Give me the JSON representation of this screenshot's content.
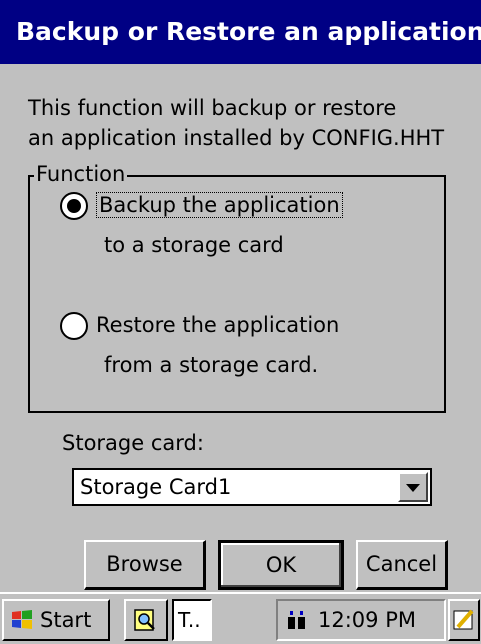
{
  "window": {
    "title": "Backup or Restore an application",
    "description_line1": "This function will backup or restore",
    "description_line2": "an application installed by CONFIG.HHT"
  },
  "function_group": {
    "legend": "Function",
    "options": [
      {
        "line1": "Backup the application",
        "line2": "to a storage card",
        "selected": true
      },
      {
        "line1": "Restore the application",
        "line2": "from a storage card.",
        "selected": false
      }
    ]
  },
  "storage": {
    "label": "Storage card:",
    "selected_value": "Storage Card1"
  },
  "buttons": {
    "browse": "Browse",
    "ok": "OK",
    "cancel": "Cancel"
  },
  "taskbar": {
    "start_label": "Start",
    "task_label": "T..",
    "clock": "12:09 PM"
  },
  "colors": {
    "title_bg": "#000084",
    "face": "#c0c0c0"
  }
}
